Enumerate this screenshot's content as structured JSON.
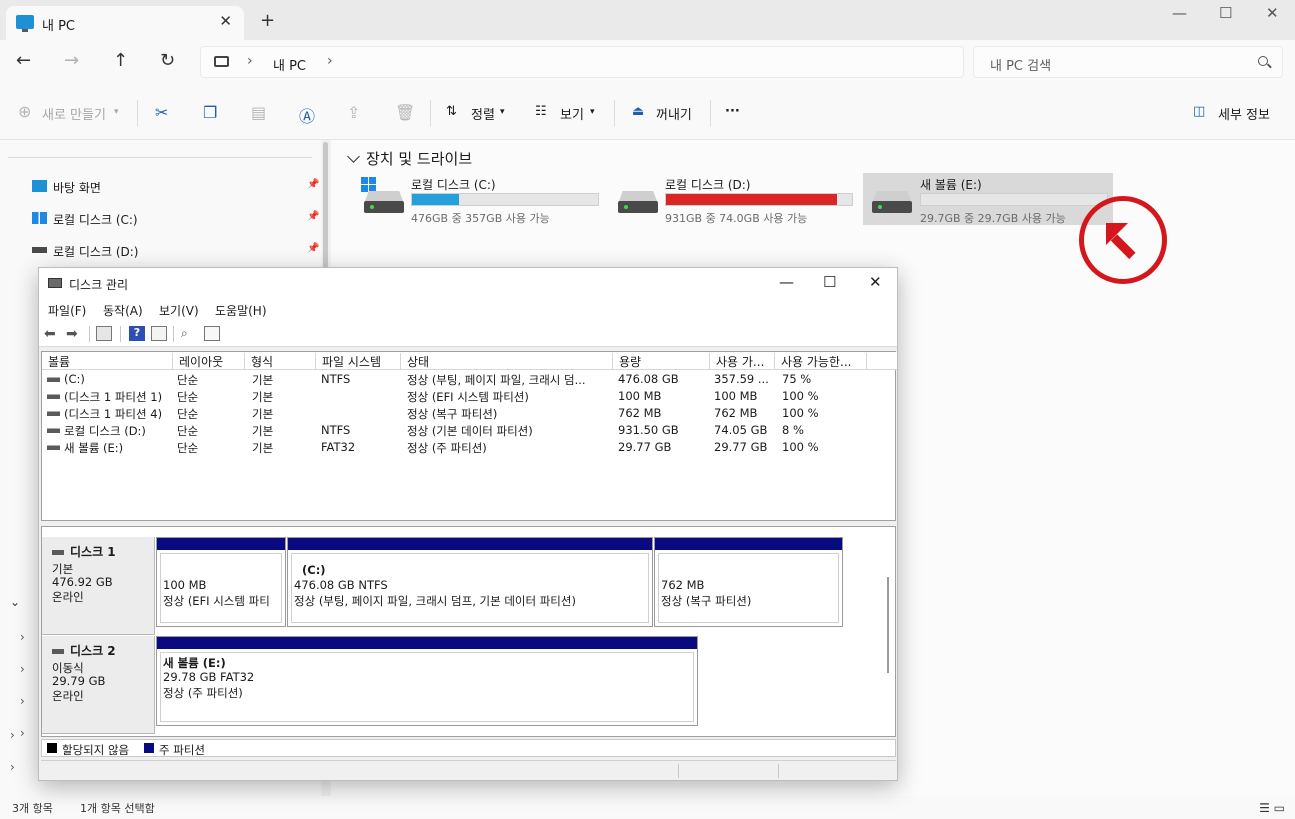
{
  "explorer": {
    "tab_title": "내 PC",
    "tab_close": "✕",
    "new_tab": "+",
    "window_controls": [
      "—",
      "☐",
      "✕"
    ],
    "nav": {
      "back": "←",
      "forward": "→",
      "up": "↑",
      "refresh": "↻"
    },
    "breadcrumb": {
      "sep": "›",
      "item": "내 PC",
      "sep2": "›"
    },
    "search_placeholder": "내 PC 검색",
    "commands": {
      "new": "새로 만들기",
      "sort": "정렬",
      "view": "보기",
      "eject": "꺼내기",
      "more": "···",
      "details": "세부 정보"
    },
    "sidebar": [
      {
        "label": "바탕 화면",
        "icon": "desktop-icon",
        "color": "#1e90d6"
      },
      {
        "label": "로컬 디스크 (C:)",
        "icon": "windows-drive-icon",
        "color": "#1e88e5"
      },
      {
        "label": "로컬 디스크 (D:)",
        "icon": "drive-icon",
        "color": "#4a4a4a"
      }
    ],
    "group_title": "장치 및 드라이브",
    "drives": [
      {
        "name": "로컬 디스크 (C:)",
        "free": "476GB 중 357GB 사용 가능",
        "used_fraction": 0.25,
        "bar_color": "#26a0da"
      },
      {
        "name": "로컬 디스크 (D:)",
        "free": "931GB 중 74.0GB 사용 가능",
        "used_fraction": 0.92,
        "bar_color": "#da2626"
      },
      {
        "name": "새 볼륨 (E:)",
        "free": "29.7GB 중 29.7GB 사용 가능",
        "used_fraction": 0.0,
        "bar_color": "#26a0da"
      }
    ],
    "status": {
      "items": "3개 항목",
      "selected": "1개 항목 선택함"
    }
  },
  "disk_mgmt": {
    "title": "디스크 관리",
    "menu": [
      "파일(F)",
      "동작(A)",
      "보기(V)",
      "도움말(H)"
    ],
    "columns": [
      "볼륨",
      "레이아웃",
      "형식",
      "파일 시스템",
      "상태",
      "용량",
      "사용 가...",
      "사용 가능한..."
    ],
    "rows": [
      [
        "(C:)",
        "단순",
        "기본",
        "NTFS",
        "정상 (부팅, 페이지 파일, 크래시 덤...",
        "476.08 GB",
        "357.59 ...",
        "75 %"
      ],
      [
        "(디스크 1 파티션 1)",
        "단순",
        "기본",
        "",
        "정상 (EFI 시스템 파티션)",
        "100 MB",
        "100 MB",
        "100 %"
      ],
      [
        "(디스크 1 파티션 4)",
        "단순",
        "기본",
        "",
        "정상 (복구 파티션)",
        "762 MB",
        "762 MB",
        "100 %"
      ],
      [
        "로컬 디스크 (D:)",
        "단순",
        "기본",
        "NTFS",
        "정상 (기본 데이터 파티션)",
        "931.50 GB",
        "74.05 GB",
        "8 %"
      ],
      [
        "새 볼륨 (E:)",
        "단순",
        "기본",
        "FAT32",
        "정상 (주 파티션)",
        "29.77 GB",
        "29.77 GB",
        "100 %"
      ]
    ],
    "disks": [
      {
        "name": "디스크 1",
        "type": "기본",
        "size": "476.92 GB",
        "state": "온라인",
        "partitions": [
          {
            "title": "",
            "line1": "100 MB",
            "line2": "정상 (EFI 시스템 파티"
          },
          {
            "title": "(C:)",
            "line1": "476.08 GB NTFS",
            "line2": "정상 (부팅, 페이지 파일, 크래시 덤프, 기본 데이터 파티션)"
          },
          {
            "title": "",
            "line1": "762 MB",
            "line2": "정상 (복구 파티션)"
          }
        ]
      },
      {
        "name": "디스크 2",
        "type": "이동식",
        "size": "29.79 GB",
        "state": "온라인",
        "partitions": [
          {
            "title": "새 볼륨  (E:)",
            "line1": "29.78 GB FAT32",
            "line2": "정상 (주 파티션)"
          }
        ]
      }
    ],
    "legend": [
      {
        "label": "할당되지 않음",
        "color": "#000000"
      },
      {
        "label": "주 파티션",
        "color": "#0a0a80"
      }
    ]
  }
}
